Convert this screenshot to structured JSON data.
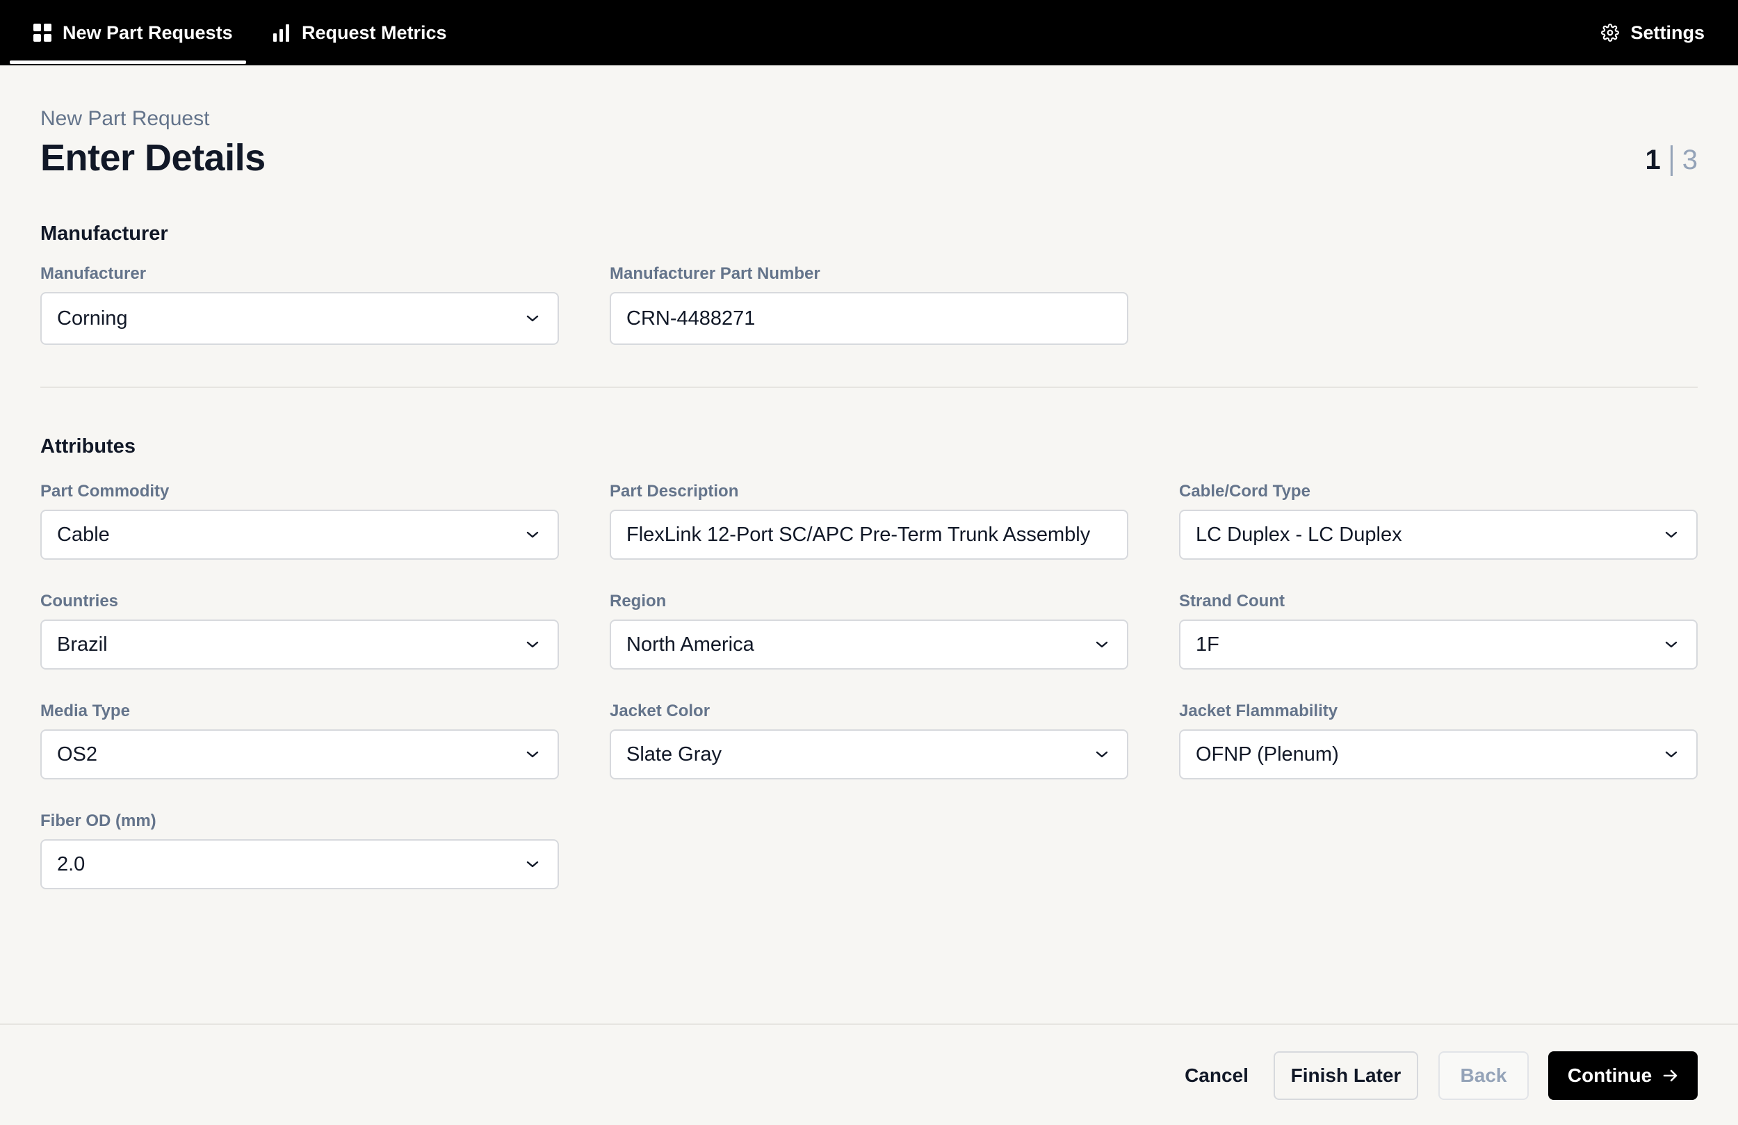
{
  "nav": {
    "tabs": [
      {
        "label": "New Part Requests",
        "icon": "grid-icon",
        "active": true
      },
      {
        "label": "Request Metrics",
        "icon": "bar-chart-icon",
        "active": false
      }
    ],
    "settings_label": "Settings"
  },
  "header": {
    "breadcrumb": "New Part Request",
    "title": "Enter Details",
    "step_current": "1",
    "step_total": "3"
  },
  "sections": {
    "manufacturer_title": "Manufacturer",
    "attributes_title": "Attributes"
  },
  "manufacturer": {
    "manufacturer": {
      "label": "Manufacturer",
      "value": "Corning"
    },
    "part_number": {
      "label": "Manufacturer Part Number",
      "value": "CRN-4488271"
    }
  },
  "attributes": {
    "part_commodity": {
      "label": "Part Commodity",
      "value": "Cable"
    },
    "part_description": {
      "label": "Part Description",
      "value": "FlexLink 12-Port SC/APC Pre-Term Trunk Assembly"
    },
    "cable_cord_type": {
      "label": "Cable/Cord Type",
      "value": "LC Duplex - LC Duplex"
    },
    "countries": {
      "label": "Countries",
      "value": "Brazil"
    },
    "region": {
      "label": "Region",
      "value": "North America"
    },
    "strand_count": {
      "label": "Strand Count",
      "value": "1F"
    },
    "media_type": {
      "label": "Media Type",
      "value": "OS2"
    },
    "jacket_color": {
      "label": "Jacket Color",
      "value": "Slate Gray"
    },
    "jacket_flammability": {
      "label": "Jacket Flammability",
      "value": "OFNP (Plenum)"
    },
    "fiber_od": {
      "label": "Fiber OD (mm)",
      "value": "2.0"
    }
  },
  "footer": {
    "cancel_label": "Cancel",
    "finish_later_label": "Finish Later",
    "back_label": "Back",
    "continue_label": "Continue"
  },
  "colors": {
    "background": "#f7f6f3",
    "nav": "#000000",
    "label": "#64748b",
    "primary_button": "#000000"
  }
}
